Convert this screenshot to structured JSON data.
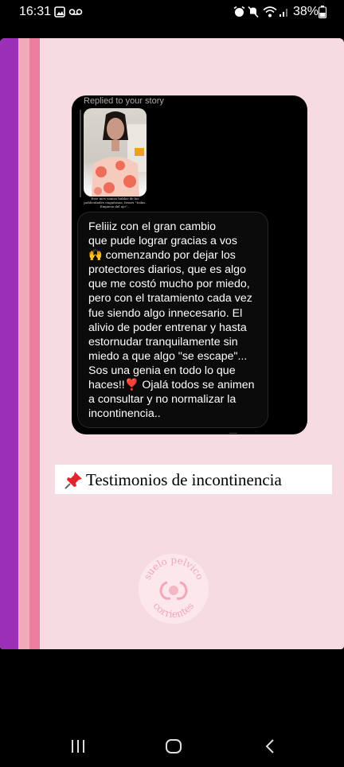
{
  "status_bar": {
    "time": "16:31",
    "battery": "38%",
    "icons": [
      "image-icon",
      "voicemail-icon",
      "alarm-icon",
      "mute-icon",
      "wifi-icon",
      "signal-icon",
      "battery-icon"
    ]
  },
  "story": {
    "reply_label": "Replied to your story",
    "thumbnail_caption": "Este mes vamos hablar de las publicidades engañosas, frases \"todas. Empieza del ojo\"...",
    "message": "Feliiiz con el gran cambio\nque pude lograr gracias a vos\n🙌 comenzando por dejar los\nprotectores diarios, que es algo\nque me costó mucho por miedo,\npero con el tratamiento cada vez\nfue siendo algo innecesario. El\nalivio de poder entrenar y hasta\nestornudar tranquilamente sin\nmiedo a que algo \"se escape\"...\nSos una genia en todo lo que\nhaces!!❣️ Ojalá todos se animen\na consultar y no normalizar la\nincontinencia..",
    "title": "Testimonios de incontinencia",
    "logo_top": "suelo pelvico",
    "logo_bottom": "corrientes"
  },
  "colors": {
    "stripe_purple": "#9b2fb8",
    "stripe_light_pink": "#f2a9b9",
    "stripe_pink": "#ec7ea0",
    "background_pink": "#f6dce2"
  },
  "nav_bar": {
    "buttons": [
      "recent-apps-icon",
      "home-icon",
      "back-icon"
    ]
  }
}
